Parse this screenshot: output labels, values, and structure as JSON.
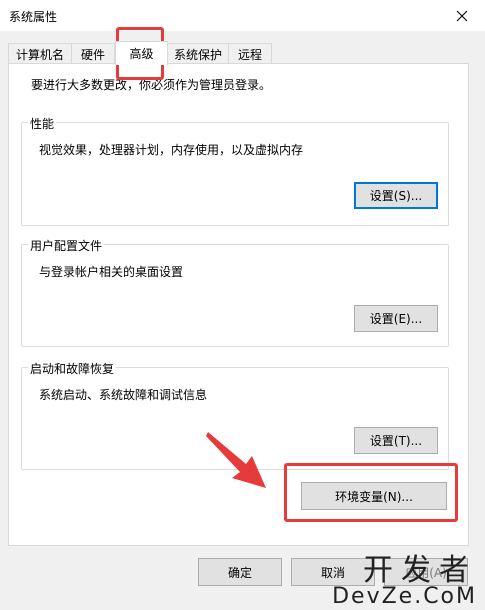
{
  "window": {
    "title": "系统属性"
  },
  "tabs": [
    {
      "label": "计算机名"
    },
    {
      "label": "硬件"
    },
    {
      "label": "高级"
    },
    {
      "label": "系统保护"
    },
    {
      "label": "远程"
    }
  ],
  "advanced": {
    "admin_note": "要进行大多数更改，你必须作为管理员登录。",
    "performance": {
      "label": "性能",
      "desc": "视觉效果，处理器计划，内存使用，以及虚拟内存",
      "button": "设置(S)..."
    },
    "user_profiles": {
      "label": "用户配置文件",
      "desc": "与登录帐户相关的桌面设置",
      "button": "设置(E)..."
    },
    "startup_recovery": {
      "label": "启动和故障恢复",
      "desc": "系统启动、系统故障和调试信息",
      "button": "设置(T)..."
    },
    "env_button": "环境变量(N)..."
  },
  "footer": {
    "ok": "确定",
    "cancel": "取消",
    "apply": "应用(A)"
  },
  "watermark": {
    "line1": "开发者",
    "line2": "DevZe.CoM"
  },
  "colors": {
    "annotation_red": "#e63b3b",
    "focus_blue": "#0078d7"
  }
}
